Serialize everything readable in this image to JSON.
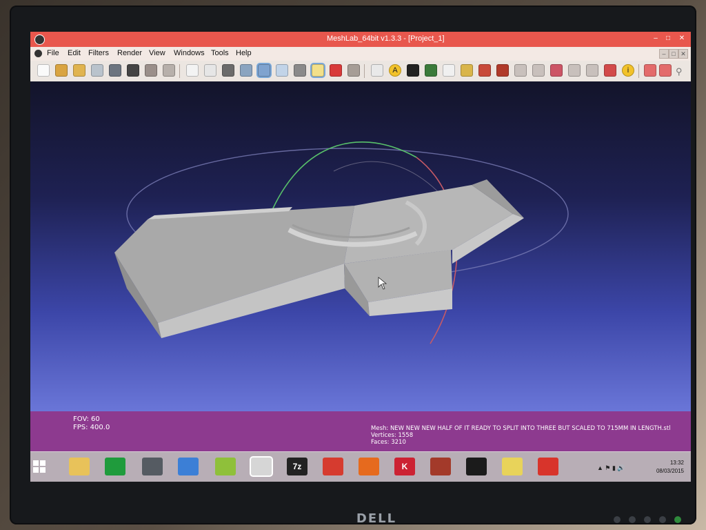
{
  "window": {
    "title": "MeshLab_64bit v1.3.3 - [Project_1]",
    "minimize_symbol": "–",
    "maximize_symbol": "□",
    "close_symbol": "✕"
  },
  "menu": {
    "items": [
      "File",
      "Edit",
      "Filters",
      "Render",
      "View",
      "Windows",
      "Tools",
      "Help"
    ]
  },
  "toolbar": {
    "annotate_label": "A",
    "info_label": "i",
    "search_icon": "search-icon"
  },
  "viewport": {
    "fov_label": "FOV: 60",
    "fps_label": "FPS:  400.0"
  },
  "mesh_info": {
    "name_label": "Mesh: NEW NEW NEW HALF OF IT READY TO SPLIT INTO THREE BUT SCALED TO 715MM IN LENGTH.stl",
    "vertices_label": "Vertices: 1558",
    "faces_label": "Faces: 3210"
  },
  "taskbar": {
    "apps": [
      {
        "name": "file-explorer",
        "color": "#e8c25a",
        "glyph": ""
      },
      {
        "name": "store",
        "color": "#1f9b3c",
        "glyph": ""
      },
      {
        "name": "search-app",
        "color": "#555b62",
        "glyph": ""
      },
      {
        "name": "network-app",
        "color": "#3c7fd6",
        "glyph": ""
      },
      {
        "name": "lime-app",
        "color": "#8fc03a",
        "glyph": ""
      },
      {
        "name": "meshlab",
        "color": "#d6d6d6",
        "glyph": ""
      },
      {
        "name": "7zip",
        "color": "#222222",
        "glyph": "7z"
      },
      {
        "name": "sketchup",
        "color": "#d63b2f",
        "glyph": ""
      },
      {
        "name": "firefox",
        "color": "#e66a1e",
        "glyph": ""
      },
      {
        "name": "k-app",
        "color": "#cc2233",
        "glyph": "K"
      },
      {
        "name": "game-app",
        "color": "#a33a2a",
        "glyph": ""
      },
      {
        "name": "terminal",
        "color": "#1b1b1b",
        "glyph": ""
      },
      {
        "name": "shield-app",
        "color": "#e8d35a",
        "glyph": ""
      },
      {
        "name": "red-app",
        "color": "#d8342b",
        "glyph": ""
      }
    ],
    "clock_time": "13:32",
    "clock_date": "08/03/2015"
  },
  "colors": {
    "titlebar": "#e8574d",
    "infobar": "#8d3a8f",
    "mesh": "#bdbdbd"
  },
  "monitor": {
    "brand": "DELL"
  }
}
